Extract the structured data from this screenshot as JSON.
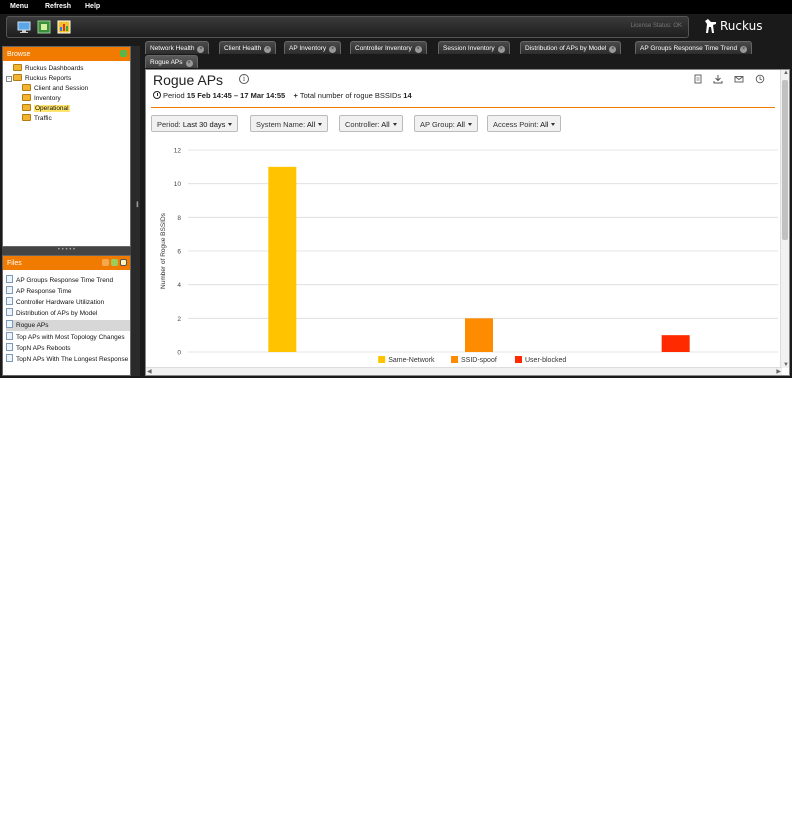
{
  "menu": {
    "items": [
      "Menu",
      "Refresh",
      "Help"
    ]
  },
  "header": {
    "license_status": "License Status: OK",
    "brand": "Ruckus"
  },
  "browse": {
    "title": "Browse",
    "tree": [
      {
        "label": "Ruckus Dashboards",
        "level": 0,
        "expander": ""
      },
      {
        "label": "Ruckus Reports",
        "level": 0,
        "expander": "-"
      },
      {
        "label": "Client and Session",
        "level": 1
      },
      {
        "label": "Inventory",
        "level": 1
      },
      {
        "label": "Operational",
        "level": 1,
        "selected": true
      },
      {
        "label": "Traffic",
        "level": 1
      }
    ]
  },
  "files": {
    "title": "Files",
    "items": [
      "AP Groups Response Time Trend",
      "AP Response Time",
      "Controller Hardware Utilization",
      "Distribution of APs by Model",
      "Rogue APs",
      "Top APs with Most Topology Changes",
      "TopN APs Reboots",
      "TopN APs With The Longest Response"
    ],
    "selected": "Rogue APs"
  },
  "tabs": [
    "Network Health",
    "Client Health",
    "AP Inventory",
    "Controller Inventory",
    "Session Inventory",
    "Distribution of APs by Model",
    "AP Groups Response Time Trend",
    "Rogue APs"
  ],
  "active_tab": "Rogue APs",
  "report": {
    "title": "Rogue APs",
    "period_label": "Period",
    "period_value": "15 Feb 14:45 – 17 Mar 14:55",
    "total_label": "Total number of rogue BSSIDs",
    "total_value": "14"
  },
  "filters": [
    {
      "label": "Period:",
      "value": "Last 30 days"
    },
    {
      "label": "System Name:",
      "value": "All"
    },
    {
      "label": "Controller:",
      "value": "All"
    },
    {
      "label": "AP Group:",
      "value": "All"
    },
    {
      "label": "Access Point:",
      "value": "All"
    }
  ],
  "colors": {
    "accent": "#f07b00",
    "same_network": "#ffc300",
    "ssid_spoof": "#ff8c00",
    "user_blocked": "#ff2a00"
  },
  "chart_data": {
    "type": "bar",
    "ylabel": "Number of Rogue BSSIDs",
    "ylim": [
      0,
      12
    ],
    "yticks": [
      0,
      2,
      4,
      6,
      8,
      10,
      12
    ],
    "grid": true,
    "legend": "bottom",
    "series": [
      {
        "name": "Same-Network",
        "values": [
          11
        ],
        "color": "#ffc300"
      },
      {
        "name": "SSID-spoof",
        "values": [
          2
        ],
        "color": "#ff8c00"
      },
      {
        "name": "User-blocked",
        "values": [
          1
        ],
        "color": "#ff2a00"
      }
    ]
  }
}
